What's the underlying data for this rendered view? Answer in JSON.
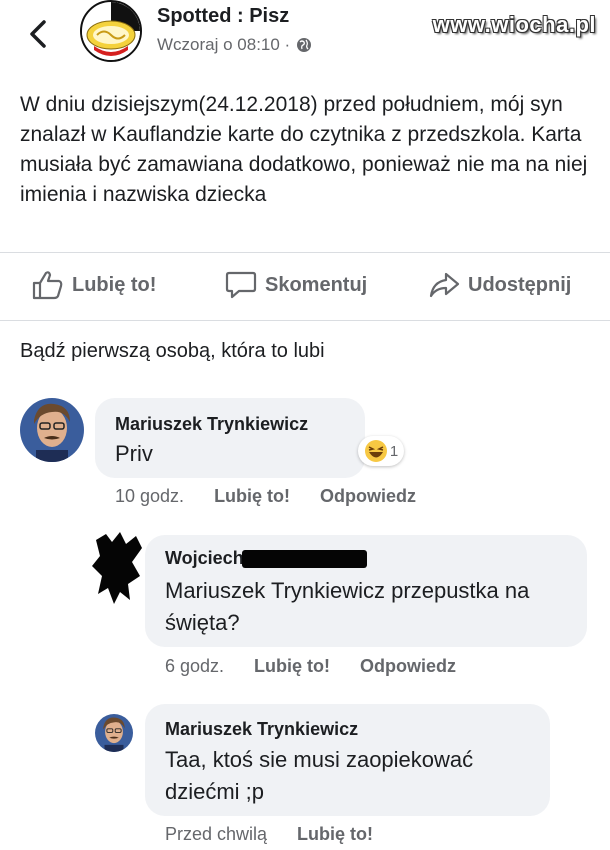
{
  "header": {
    "page_name": "Spotted : Pisz",
    "time": "Wczoraj o 08:10 ·",
    "privacy_icon": "globe-icon",
    "watermark": "www.wiocha.pl"
  },
  "post": {
    "text": "W dniu dzisiejszym(24.12.2018) przed południem, mój syn znalazł w Kauflandzie karte do czytnika z przedszkola. Karta musiała być zamawiana dodatkowo, ponieważ nie ma na niej imienia i nazwiska dziecka"
  },
  "actions": {
    "like": "Lubię to!",
    "comment": "Skomentuj",
    "share": "Udostępnij"
  },
  "first_like_text": "Bądź pierwszą osobą, która to lubi",
  "comments": [
    {
      "author": "Mariuszek Trynkiewicz",
      "text": "Priv",
      "reaction_count": "1",
      "reaction_icon": "haha-emoji-icon",
      "time": "10 godz.",
      "like": "Lubię to!",
      "reply": "Odpowiedz"
    },
    {
      "author": "Wojciech",
      "text": "Mariuszek Trynkiewicz przepustka na święta?",
      "time": "6 godz.",
      "like": "Lubię to!",
      "reply": "Odpowiedz"
    },
    {
      "author": "Mariuszek Trynkiewicz",
      "text": "Taa, ktoś sie musi zaopiekować dziećmi ;p",
      "time": "Przed chwilą",
      "like": "Lubię to!"
    }
  ],
  "colors": {
    "text": "#1c1e21",
    "muted": "#65676b",
    "bubble": "#f0f2f5",
    "divider": "#dadde1"
  }
}
